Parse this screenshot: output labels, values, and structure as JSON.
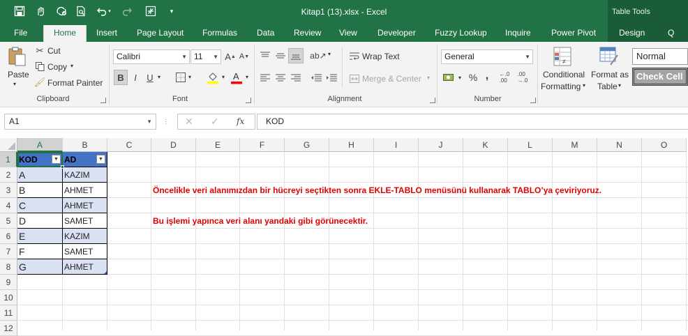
{
  "window": {
    "title": "Kitap1 (13).xlsx  -  Excel",
    "contextual_group": "Table Tools"
  },
  "quick_access": [
    "save-icon",
    "touch-mode-icon",
    "sync-icon",
    "print-preview-icon",
    "undo-icon",
    "redo-icon",
    "customize-icon",
    "more-icon"
  ],
  "tabs": [
    {
      "label": "File",
      "active": false
    },
    {
      "label": "Home",
      "active": true
    },
    {
      "label": "Insert",
      "active": false
    },
    {
      "label": "Page Layout",
      "active": false
    },
    {
      "label": "Formulas",
      "active": false
    },
    {
      "label": "Data",
      "active": false
    },
    {
      "label": "Review",
      "active": false
    },
    {
      "label": "View",
      "active": false
    },
    {
      "label": "Developer",
      "active": false
    },
    {
      "label": "Fuzzy Lookup",
      "active": false
    },
    {
      "label": "Inquire",
      "active": false
    },
    {
      "label": "Power Pivot",
      "active": false
    },
    {
      "label": "Design",
      "active": false
    },
    {
      "label": "Q",
      "active": false
    }
  ],
  "ribbon": {
    "clipboard": {
      "paste": "Paste",
      "cut": "Cut",
      "copy": "Copy",
      "format_painter": "Format Painter",
      "group": "Clipboard"
    },
    "font": {
      "name": "Calibri",
      "size": "11",
      "group": "Font",
      "bold": "B",
      "italic": "I",
      "underline": "U"
    },
    "alignment": {
      "wrap_text": "Wrap Text",
      "merge_center": "Merge & Center",
      "group": "Alignment"
    },
    "number": {
      "format": "General",
      "percent": "%",
      "comma": ",",
      "group": "Number"
    },
    "styles": {
      "conditional_line1": "Conditional",
      "conditional_line2": "Formatting",
      "format_table_line1": "Format as",
      "format_table_line2": "Table",
      "normal": "Normal",
      "check_cell": "Check Cell"
    }
  },
  "formula_bar": {
    "name_box": "A1",
    "fx": "fx",
    "value": "KOD"
  },
  "columns": [
    "A",
    "B",
    "C",
    "D",
    "E",
    "F",
    "G",
    "H",
    "I",
    "J",
    "K",
    "L",
    "M",
    "N",
    "O"
  ],
  "rows": [
    "1",
    "2",
    "3",
    "4",
    "5",
    "6",
    "7",
    "8",
    "9",
    "10",
    "11",
    "12"
  ],
  "table": {
    "headers": [
      "KOD",
      "AD"
    ],
    "rows": [
      [
        "A",
        "KAZIM"
      ],
      [
        "B",
        "AHMET"
      ],
      [
        "C",
        "AHMET"
      ],
      [
        "D",
        "SAMET"
      ],
      [
        "E",
        "KAZIM"
      ],
      [
        "F",
        "SAMET"
      ],
      [
        "G",
        "AHMET"
      ]
    ]
  },
  "notes": {
    "line1": "Öncelikle veri alanımızdan bir hücreyi seçtikten sonra EKLE-TABLO menüsünü kullanarak TABLO’ya çeviriyoruz.",
    "line2": "Bu işlemi yapınca veri alanı yandaki gibi görünecektir."
  },
  "colors": {
    "excel_green": "#217346",
    "table_header": "#4472c4",
    "table_band": "#d9e1f2",
    "note_red": "#e00000"
  }
}
